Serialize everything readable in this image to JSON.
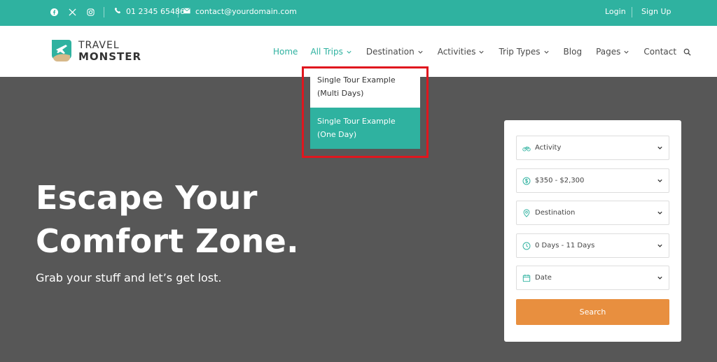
{
  "topbar": {
    "social": [
      "facebook-icon",
      "x-icon",
      "instagram-icon"
    ],
    "phone": "01 2345 65486",
    "email": "contact@yourdomain.com",
    "login": "Login",
    "signup": "Sign Up"
  },
  "logo": {
    "line1": "TRAVEL",
    "line2": "MONSTER"
  },
  "nav": {
    "items": [
      {
        "label": "Home",
        "active": true
      },
      {
        "label": "All Trips",
        "active": true
      },
      {
        "label": "Destination"
      },
      {
        "label": "Activities"
      },
      {
        "label": "Trip Types"
      },
      {
        "label": "Blog"
      },
      {
        "label": "Pages"
      },
      {
        "label": "Contact"
      }
    ]
  },
  "dropdown": {
    "items": [
      {
        "line1": "Single Tour Example",
        "line2": "(Multi Days)"
      },
      {
        "line1": "Single Tour Example",
        "line2": "(One Day)"
      }
    ]
  },
  "hero": {
    "title_line1": "Escape Your",
    "title_line2": "Comfort Zone.",
    "subtitle": "Grab your stuff and let’s get lost."
  },
  "search_form": {
    "fields": [
      {
        "label": "Activity",
        "icon": "bicycle-icon"
      },
      {
        "label": "$350 - $2,300",
        "icon": "dollar-icon"
      },
      {
        "label": "Destination",
        "icon": "location-pin-icon"
      },
      {
        "label": "0 Days - 11 Days",
        "icon": "clock-icon"
      },
      {
        "label": "Date",
        "icon": "calendar-icon"
      }
    ],
    "button": "Search"
  },
  "colors": {
    "accent": "#2fb2a0",
    "button": "#e88f3f",
    "hero_bg": "#575757",
    "highlight_box": "#e0161e"
  }
}
